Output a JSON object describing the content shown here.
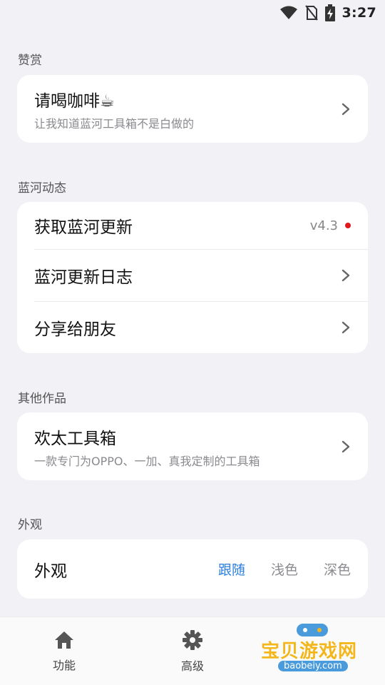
{
  "status_bar": {
    "time": "3:27"
  },
  "sections": {
    "donate": {
      "header": "赞赏",
      "item": {
        "title": "请喝咖啡☕",
        "subtitle": "让我知道蓝河工具箱不是白做的"
      }
    },
    "news": {
      "header": "蓝河动态",
      "items": [
        {
          "title": "获取蓝河更新",
          "badge": "v4.3"
        },
        {
          "title": "蓝河更新日志"
        },
        {
          "title": "分享给朋友"
        }
      ]
    },
    "works": {
      "header": "其他作品",
      "item": {
        "title": "欢太工具箱",
        "subtitle": "一款专门为OPPO、一加、真我定制的工具箱"
      }
    },
    "appearance": {
      "header": "外观",
      "item": {
        "title": "外观",
        "options": [
          "跟随",
          "浅色",
          "深色"
        ],
        "selected": "跟随"
      }
    }
  },
  "bottom_nav": {
    "items": [
      {
        "label": "功能",
        "icon": "home-icon"
      },
      {
        "label": "高级",
        "icon": "gear-icon"
      }
    ]
  },
  "watermark": {
    "text": "宝贝游戏网",
    "url": "baobeiy.com"
  },
  "colors": {
    "accent": "#2a7de1",
    "badge_dot": "#e0191f",
    "background": "#f1f1f6"
  }
}
